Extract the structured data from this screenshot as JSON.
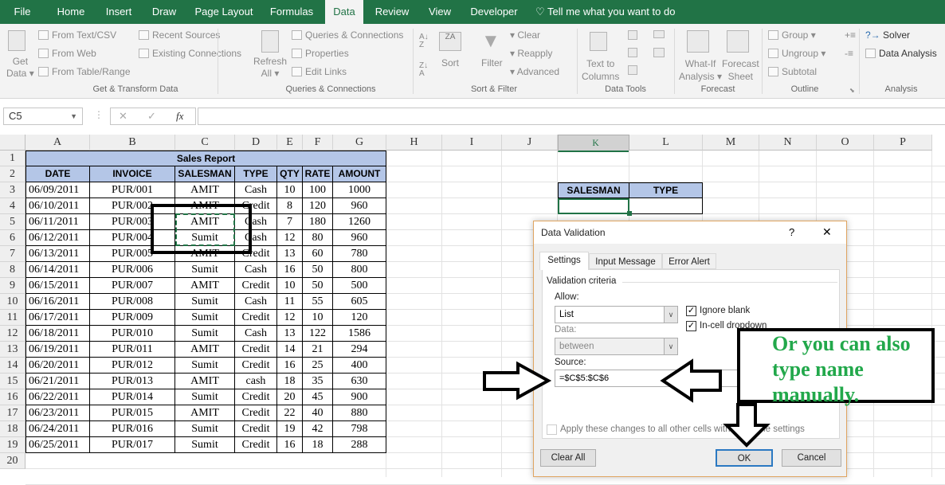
{
  "ribbon_tabs": [
    "File",
    "Home",
    "Insert",
    "Draw",
    "Page Layout",
    "Formulas",
    "Data",
    "Review",
    "View",
    "Developer"
  ],
  "tell_me": "Tell me what you want to do",
  "ribbon": {
    "get_data": [
      "Get",
      "Data"
    ],
    "from_text": "From Text/CSV",
    "from_web": "From Web",
    "from_table": "From Table/Range",
    "recent_sources": "Recent Sources",
    "existing_connections": "Existing Connections",
    "group_get_transform": "Get & Transform Data",
    "refresh_all": [
      "Refresh",
      "All"
    ],
    "queries_connections": "Queries & Connections",
    "properties": "Properties",
    "edit_links": "Edit Links",
    "group_queries": "Queries & Connections",
    "sort": "Sort",
    "filter": "Filter",
    "clear": "Clear",
    "reapply": "Reapply",
    "advanced": "Advanced",
    "group_sort_filter": "Sort & Filter",
    "text_to_columns": [
      "Text to",
      "Columns"
    ],
    "group_data_tools": "Data Tools",
    "what_if": [
      "What-If",
      "Analysis"
    ],
    "forecast_sheet": [
      "Forecast",
      "Sheet"
    ],
    "group_forecast": "Forecast",
    "group_btn": "Group",
    "ungroup": "Ungroup",
    "subtotal": "Subtotal",
    "group_outline": "Outline",
    "solver": "Solver",
    "data_analysis": "Data Analysis",
    "group_analysis": "Analysis"
  },
  "formula_bar": {
    "name_box": "C5",
    "fx": "fx",
    "formula": ""
  },
  "columns": [
    "A",
    "B",
    "C",
    "D",
    "E",
    "F",
    "G",
    "H",
    "I",
    "J",
    "K",
    "L",
    "M",
    "N",
    "O",
    "P"
  ],
  "rows": [
    "1",
    "2",
    "3",
    "4",
    "5",
    "6",
    "7",
    "8",
    "9",
    "10",
    "11",
    "12",
    "13",
    "14",
    "15",
    "16",
    "17",
    "18",
    "19",
    "20"
  ],
  "sheet": {
    "title": "Sales Report",
    "headers": [
      "DATE",
      "INVOICE",
      "SALESMAN",
      "TYPE",
      "QTY",
      "RATE",
      "AMOUNT"
    ],
    "data": [
      [
        "06/09/2011",
        "PUR/001",
        "AMIT",
        "Cash",
        "10",
        "100",
        "1000"
      ],
      [
        "06/10/2011",
        "PUR/002",
        "AMIT",
        "Credit",
        "8",
        "120",
        "960"
      ],
      [
        "06/11/2011",
        "PUR/003",
        "AMIT",
        "Cash",
        "7",
        "180",
        "1260"
      ],
      [
        "06/12/2011",
        "PUR/004",
        "Sumit",
        "Cash",
        "12",
        "80",
        "960"
      ],
      [
        "06/13/2011",
        "PUR/005",
        "AMIT",
        "Credit",
        "13",
        "60",
        "780"
      ],
      [
        "06/14/2011",
        "PUR/006",
        "Sumit",
        "Cash",
        "16",
        "50",
        "800"
      ],
      [
        "06/15/2011",
        "PUR/007",
        "AMIT",
        "Credit",
        "10",
        "50",
        "500"
      ],
      [
        "06/16/2011",
        "PUR/008",
        "Sumit",
        "Cash",
        "11",
        "55",
        "605"
      ],
      [
        "06/17/2011",
        "PUR/009",
        "Sumit",
        "Credit",
        "12",
        "10",
        "120"
      ],
      [
        "06/18/2011",
        "PUR/010",
        "Sumit",
        "Cash",
        "13",
        "122",
        "1586"
      ],
      [
        "06/19/2011",
        "PUR/011",
        "AMIT",
        "Credit",
        "14",
        "21",
        "294"
      ],
      [
        "06/20/2011",
        "PUR/012",
        "Sumit",
        "Credit",
        "16",
        "25",
        "400"
      ],
      [
        "06/21/2011",
        "PUR/013",
        "AMIT",
        "cash",
        "18",
        "35",
        "630"
      ],
      [
        "06/22/2011",
        "PUR/014",
        "Sumit",
        "Credit",
        "20",
        "45",
        "900"
      ],
      [
        "06/23/2011",
        "PUR/015",
        "AMIT",
        "Credit",
        "22",
        "40",
        "880"
      ],
      [
        "06/24/2011",
        "PUR/016",
        "Sumit",
        "Credit",
        "19",
        "42",
        "798"
      ],
      [
        "06/25/2011",
        "PUR/017",
        "Sumit",
        "Credit",
        "16",
        "18",
        "288"
      ]
    ],
    "side_table_headers": [
      "SALESMAN",
      "TYPE"
    ]
  },
  "dialog": {
    "title": "Data Validation",
    "help": "?",
    "close": "✕",
    "tabs": [
      "Settings",
      "Input Message",
      "Error Alert"
    ],
    "section": "Validation criteria",
    "allow_label": "Allow:",
    "allow_value": "List",
    "data_label": "Data:",
    "data_value": "between",
    "ignore_blank": "Ignore blank",
    "ignore_blank_checked": true,
    "in_cell_dropdown": "In-cell dropdown",
    "in_cell_dropdown_checked": true,
    "source_label": "Source:",
    "source_value": "=$C$5:$C$6",
    "apply_all": "Apply these changes to all other cells with the same settings",
    "clear_all": "Clear All",
    "ok": "OK",
    "cancel": "Cancel"
  },
  "annotation": "Or you can also type name manually."
}
